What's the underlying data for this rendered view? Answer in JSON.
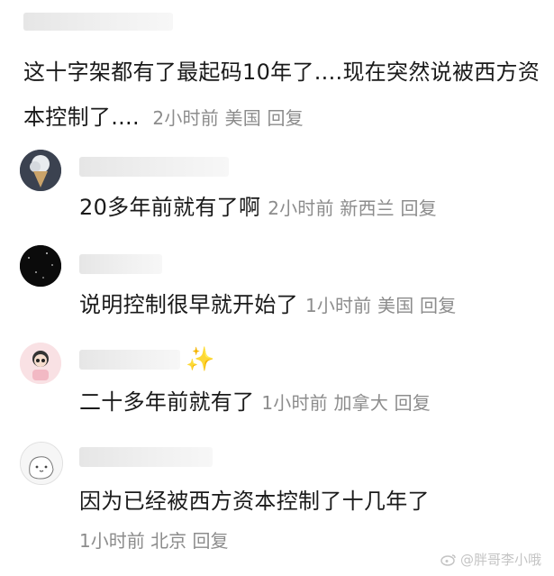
{
  "top_comment": {
    "text": "这十字架都有了最起码10年了....现在突然说被西方资本控制了....",
    "time": "2小时前",
    "location": "美国",
    "reply_label": "回复"
  },
  "replies": [
    {
      "text": "20多年前就有了啊",
      "time": "2小时前",
      "location": "新西兰",
      "reply_label": "回复",
      "avatar_icon": "ice-cream-avatar"
    },
    {
      "text": "说明控制很早就开始了",
      "time": "1小时前",
      "location": "美国",
      "reply_label": "回复",
      "avatar_icon": "starry-night-avatar"
    },
    {
      "text": "二十多年前就有了",
      "time": "1小时前",
      "location": "加拿大",
      "reply_label": "回复",
      "avatar_icon": "cartoon-girl-avatar",
      "name_decoration": "✨"
    },
    {
      "text": "因为已经被西方资本控制了十几年了",
      "time": "1小时前",
      "location": "北京",
      "reply_label": "回复",
      "avatar_icon": "doodle-cat-avatar"
    }
  ],
  "watermark": "@胖哥李小哦",
  "colors": {
    "text": "#1a1a1a",
    "meta": "#8c8c8c",
    "blur": "#eaeaea"
  }
}
